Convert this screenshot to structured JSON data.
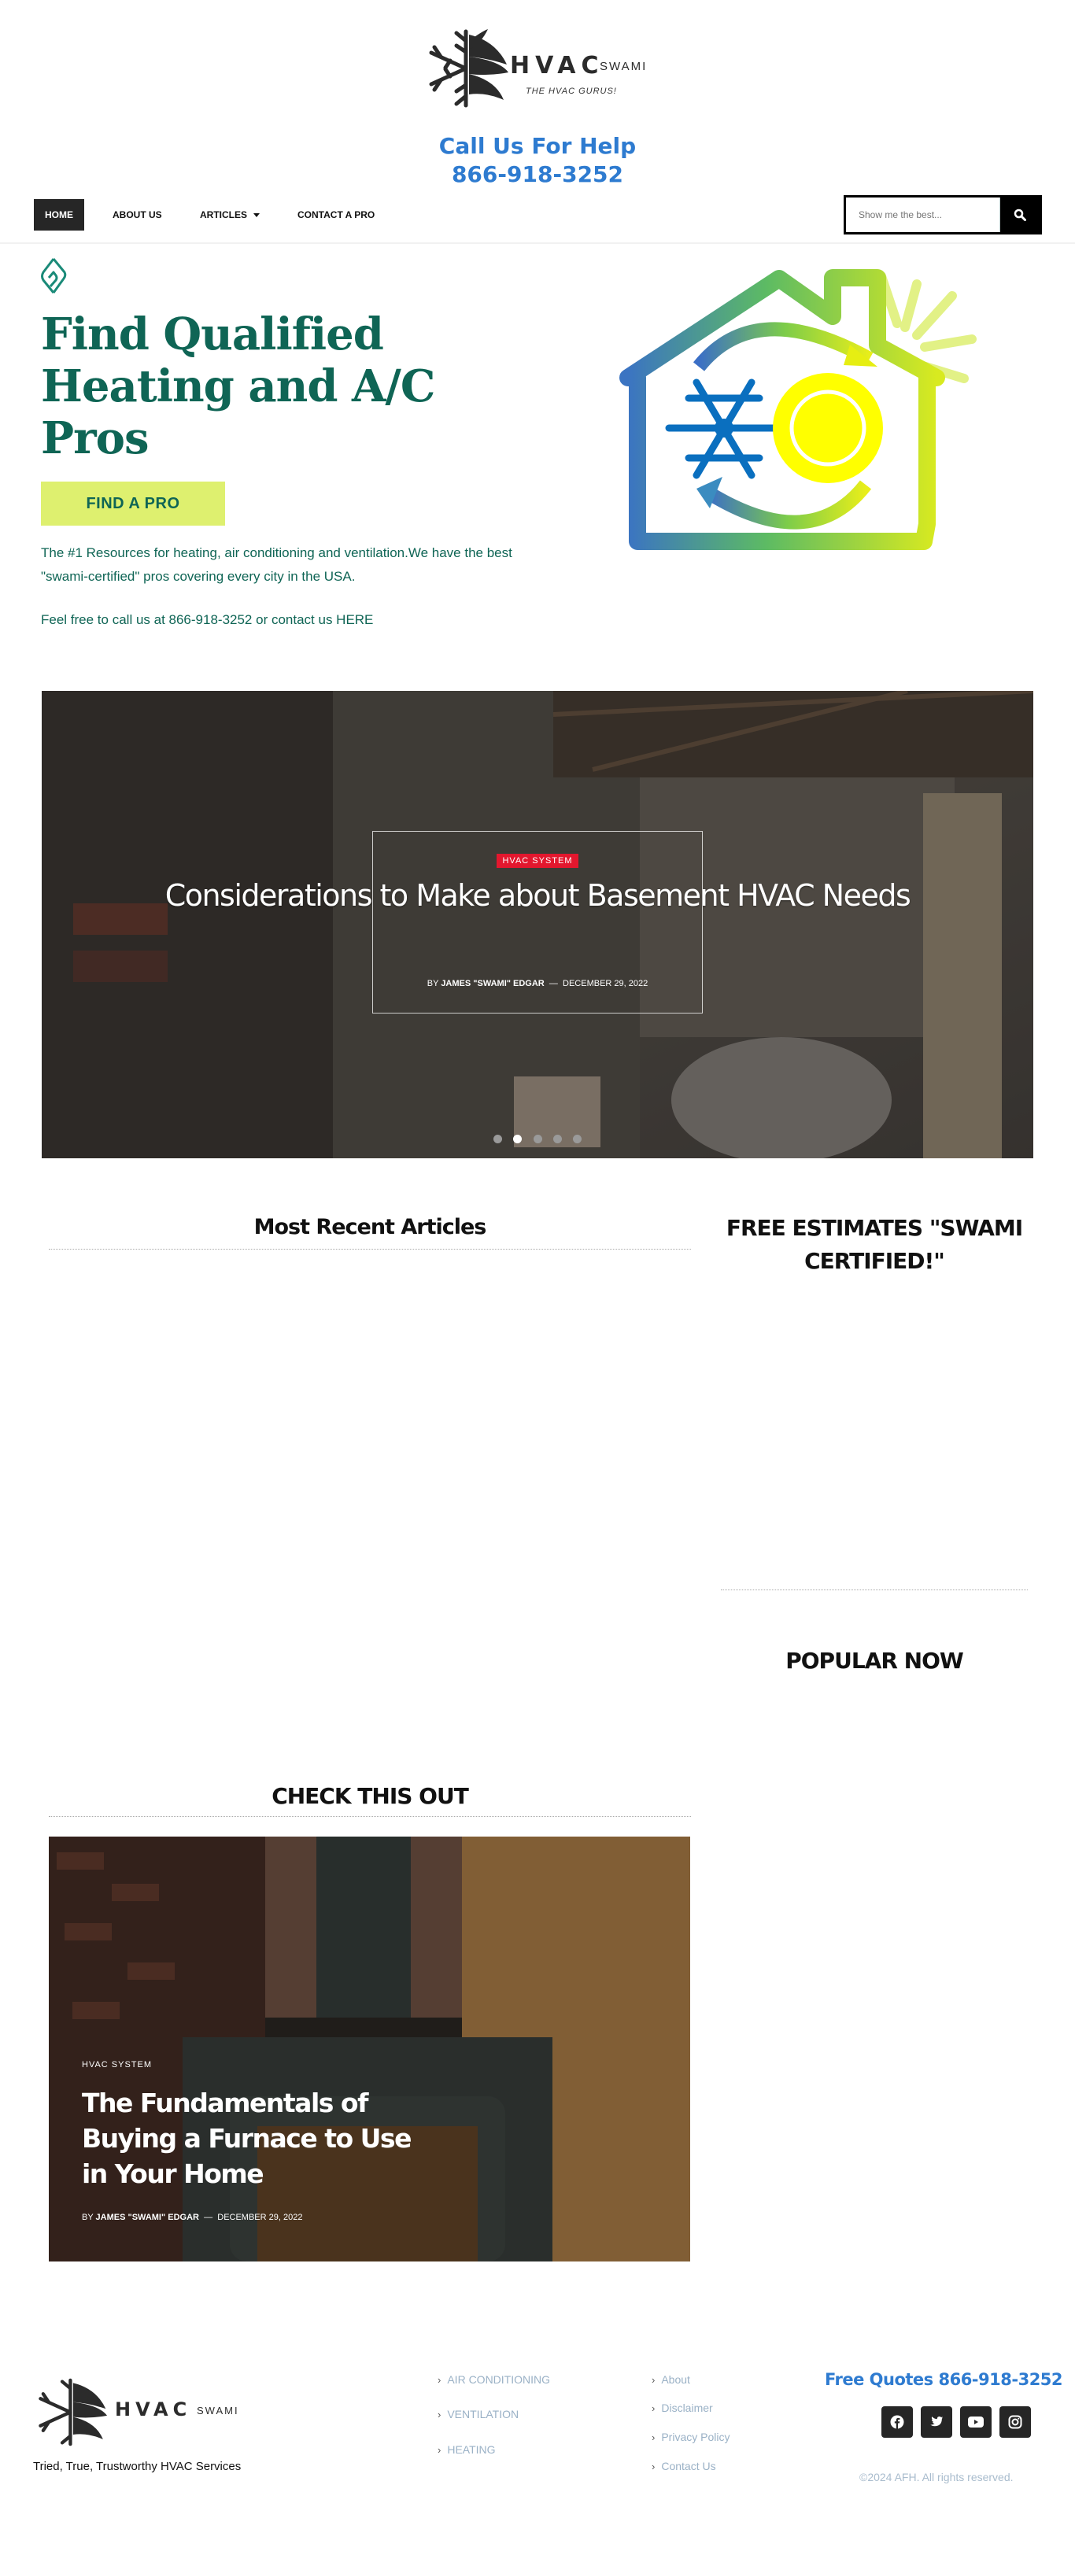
{
  "header": {
    "logo_text": "HVAC",
    "logo_swami": "SWAMI",
    "logo_tagline": "THE HVAC GURUS!",
    "call_label": "Call Us For Help",
    "phone": "866-918-3252"
  },
  "nav": {
    "items": [
      {
        "label": "HOME",
        "active": true
      },
      {
        "label": "ABOUT US"
      },
      {
        "label": "ARTICLES",
        "has_dropdown": true
      },
      {
        "label": "CONTACT A PRO"
      }
    ],
    "search_placeholder": "Show me the best..."
  },
  "hero": {
    "title": "Find Qualified Heating and A/C Pros",
    "cta_label": "FIND A PRO",
    "description": "The #1 Resources for heating, air conditioning and ventilation.We have the best \"swami-certified\" pros covering every city in the USA.",
    "contact_line": "Feel free to call us at 866-918-3252 or contact us HERE"
  },
  "slider": {
    "category": "HVAC SYSTEM",
    "title": "Considerations to Make about Basement HVAC Needs",
    "by": "BY",
    "author": "JAMES \"SWAMI\" EDGAR",
    "separator": "—",
    "date": "DECEMBER 29, 2022",
    "slide_count": 5,
    "active_slide": 2
  },
  "sections": {
    "recent_title": "Most Recent Articles",
    "free_estimates_title": "FREE ESTIMATES \"SWAMI CERTIFIED!\"",
    "popular_title": "POPULAR NOW",
    "check_title": "CHECK THIS OUT"
  },
  "featured": {
    "category": "HVAC SYSTEM",
    "title": "The Fundamentals of Buying a Furnace to Use in Your Home",
    "by": "BY",
    "author": "JAMES \"SWAMI\" EDGAR",
    "separator": "—",
    "date": "DECEMBER 29, 2022"
  },
  "footer": {
    "logo_text": "HVAC",
    "logo_swami": "SWAMI",
    "tagline": "Tried, True, Trustworthy HVAC Services",
    "category_links": [
      "AIR CONDITIONING",
      "VENTILATION",
      "HEATING"
    ],
    "page_links": [
      "About",
      "Disclaimer",
      "Privacy Policy",
      "Contact Us"
    ],
    "quotes": "Free Quotes 866-918-3252",
    "socials": [
      "facebook-icon",
      "twitter-icon",
      "youtube-icon",
      "instagram-icon"
    ],
    "copyright": "©2024 AFH. All rights reserved."
  },
  "colors": {
    "brand_green": "#0f6555",
    "accent_lime": "#def06f",
    "phone_blue": "#2e7bd0",
    "badge_red": "#e3172e",
    "nav_dark": "#262626"
  }
}
